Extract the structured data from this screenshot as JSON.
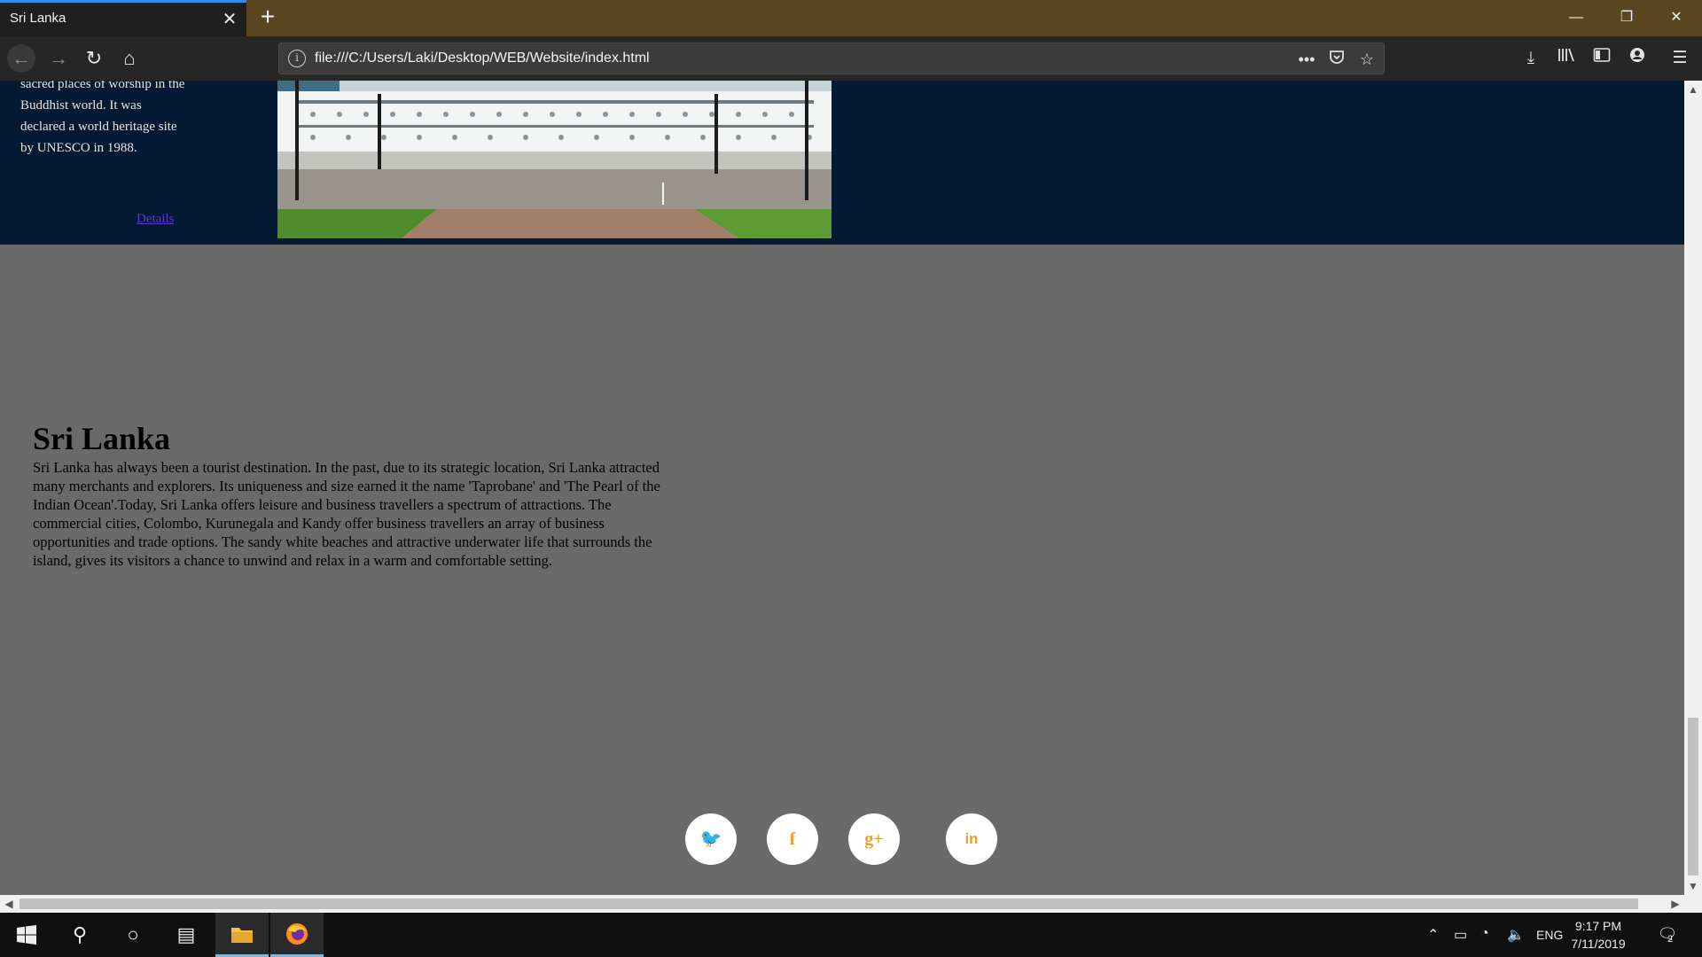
{
  "browser": {
    "tab_title": "Sri Lanka",
    "tab_close": "✕",
    "new_tab": "+",
    "url": "file:///C:/Users/Laki/Desktop/WEB/Website/index.html",
    "info_glyph": "i",
    "page_actions_glyph": "•••",
    "window_controls": {
      "minimize": "—",
      "restore": "❐",
      "close": "✕"
    }
  },
  "page": {
    "band_text": "sacred places of worship in the Buddhist world. It was declared a world heritage site by UNESCO in 1988.",
    "details_link": "Details",
    "section_title": "Sri Lanka",
    "section_body": "Sri Lanka has always been a tourist destination. In the past, due to its strategic location, Sri Lanka attracted many merchants and explorers. Its uniqueness and size earned it the name 'Taprobane' and 'The Pearl of the Indian Ocean'.Today, Sri Lanka offers leisure and business travellers a spectrum of attractions. The commercial cities, Colombo, Kurunegala and Kandy offer business travellers an array of business opportunities and trade options. The sandy white beaches and attractive underwater life that surrounds the island, gives its visitors a chance to unwind and relax in a warm and comfortable setting.",
    "social": {
      "twitter": "🐦",
      "facebook": "f",
      "googleplus": "g+",
      "linkedin": "in"
    }
  },
  "taskbar": {
    "language": "ENG",
    "time": "9:17 PM",
    "date": "7/11/2019",
    "notification_count": "2"
  },
  "colors": {
    "band": "#041a33",
    "page_bg": "#6a6a6a",
    "accent": "#e8a12b",
    "tabbar": "#5a4621"
  }
}
